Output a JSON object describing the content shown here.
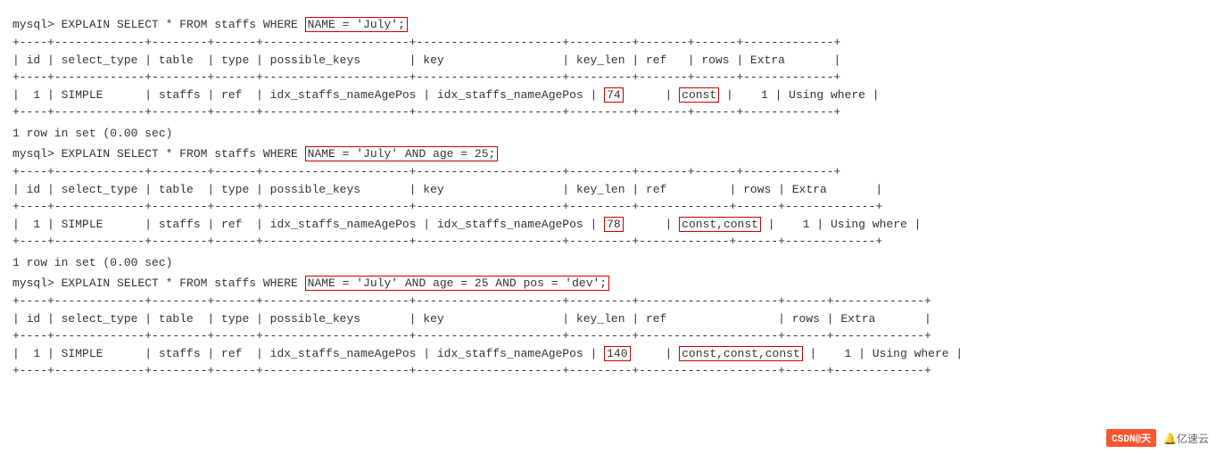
{
  "terminal": {
    "sections": [
      {
        "command_prefix": "mysql> EXPLAIN SELECT * FROM staffs WHERE ",
        "command_highlight": "NAME = 'July';",
        "divider": "+----+-------------+--------+------+---------------------+---------------------+---------+-------+------+-------------+",
        "header": "| id | select_type | table  | type | possible_keys       | key                 | key_len | ref   | rows | Extra       |",
        "row": "| 1  | SIMPLE      | staffs | ref  | idx_staffs_nameAgePos | idx_staffs_nameAgePos |",
        "key_len_val": "74",
        "ref_val": "const",
        "rows_val": "1",
        "extra_val": "Using where",
        "result": "1 row in set (0.00 sec)"
      },
      {
        "command_prefix": "mysql> EXPLAIN SELECT * FROM staffs WHERE ",
        "command_highlight": "NAME = 'July' AND age = 25;",
        "key_len_val": "78",
        "ref_val": "const,const",
        "rows_val": "1",
        "extra_val": "Using where",
        "result": "1 row in set (0.00 sec)"
      },
      {
        "command_prefix": "mysql> EXPLAIN SELECT * FROM staffs WHERE ",
        "command_highlight": "NAME = 'July' AND age = 25 AND pos = 'dev';",
        "key_len_val": "140",
        "ref_val": "const,const,const",
        "rows_val": "1",
        "extra_val": "Using where"
      }
    ],
    "footer": {
      "csdn": "CSDN@天",
      "extra": "🔔亿速云"
    }
  }
}
